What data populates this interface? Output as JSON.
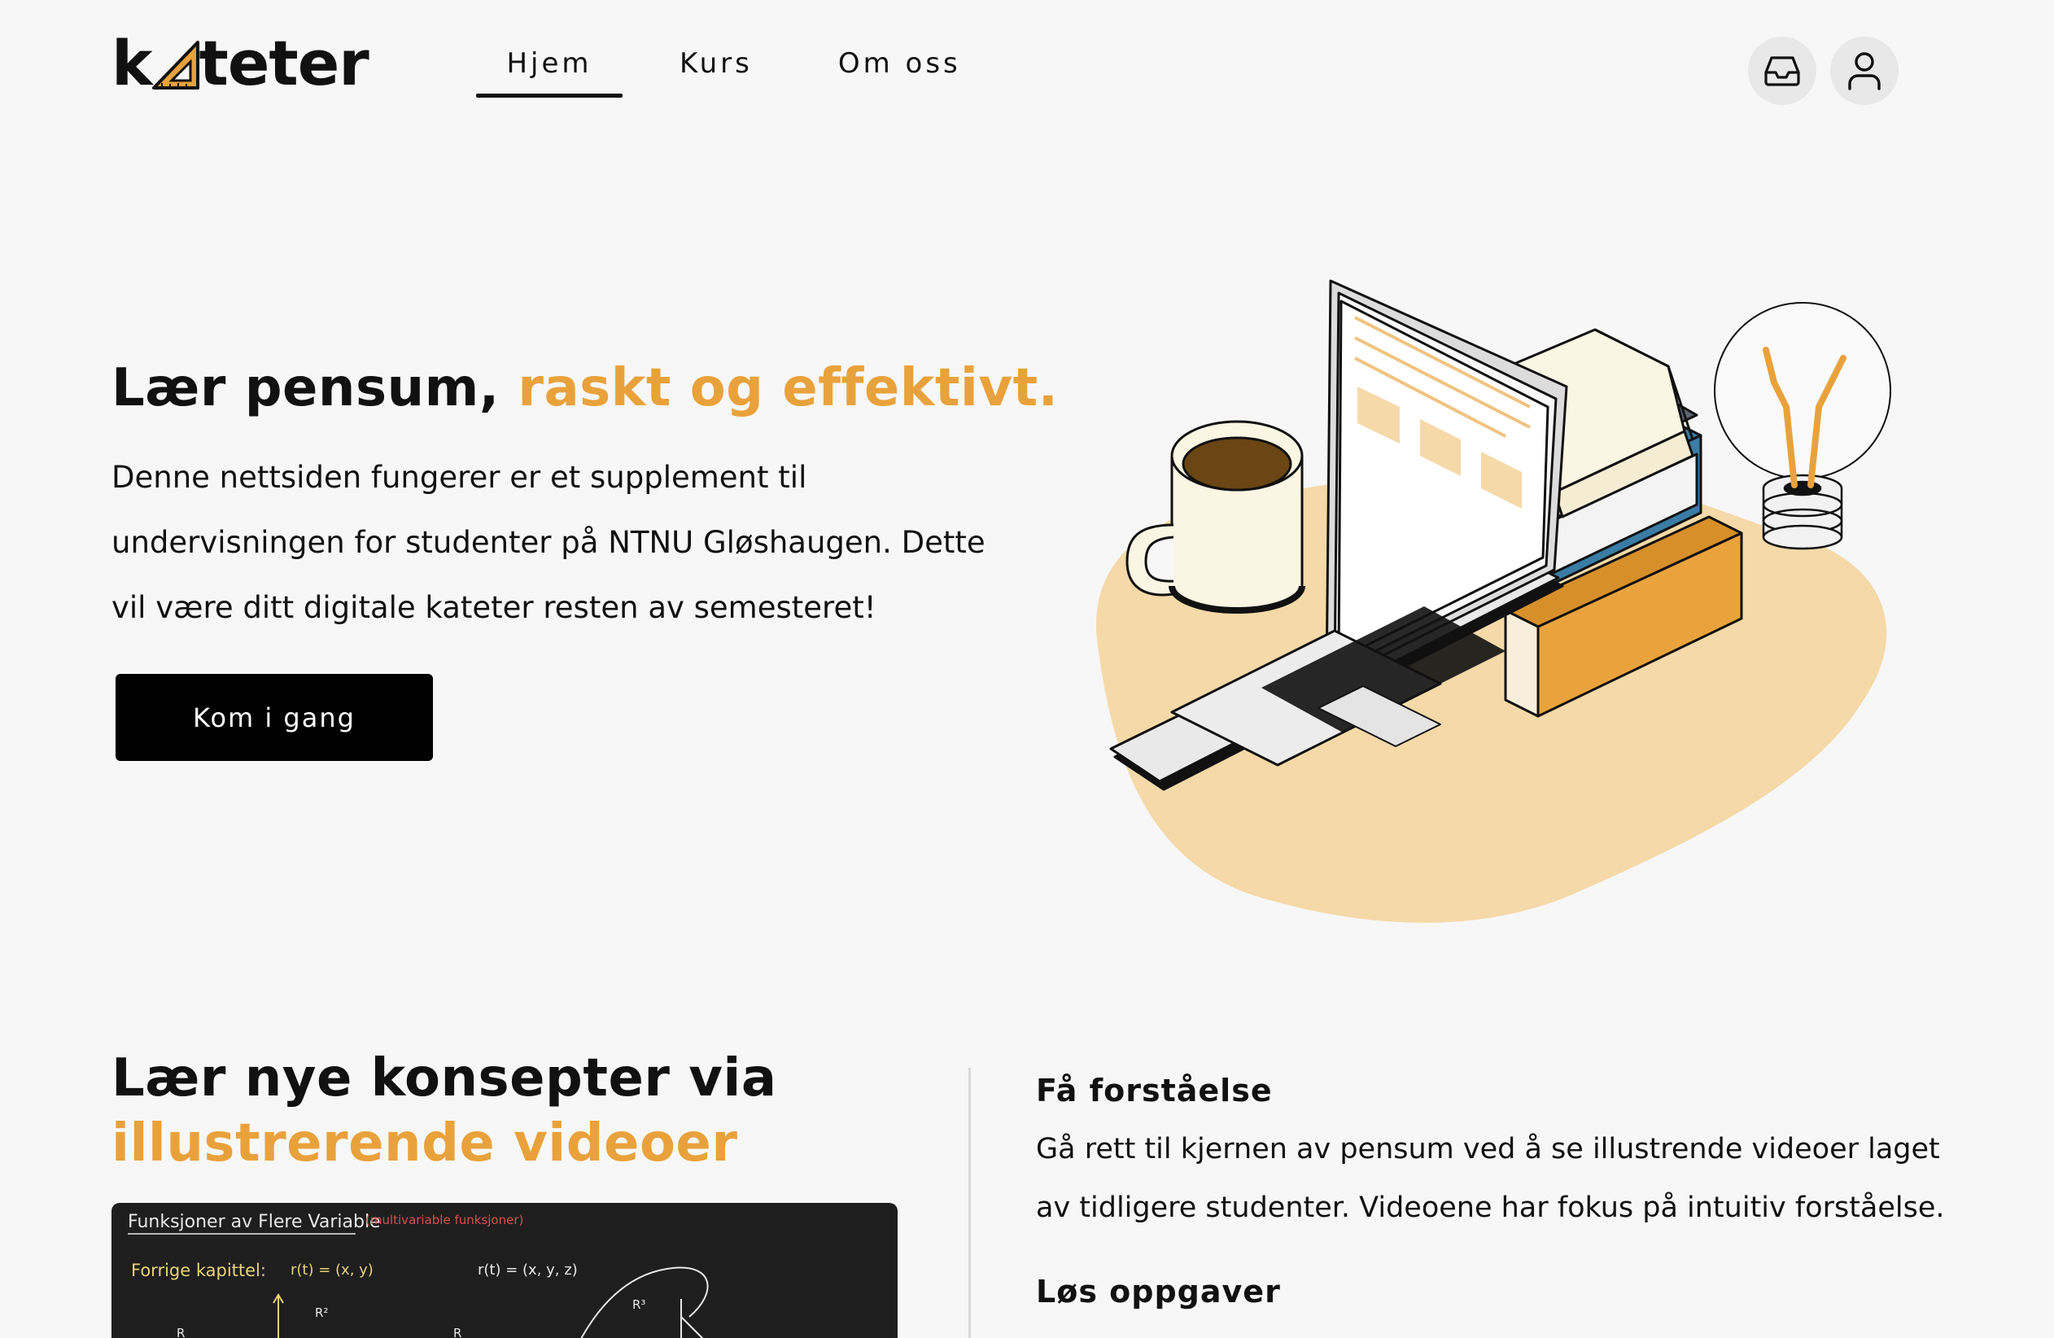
{
  "header": {
    "logo": {
      "pre": "k",
      "post": "teter"
    },
    "nav": [
      {
        "label": "Hjem",
        "active": true
      },
      {
        "label": "Kurs",
        "active": false
      },
      {
        "label": "Om oss",
        "active": false
      }
    ],
    "icons": {
      "inbox": "inbox-icon",
      "user": "user-icon"
    }
  },
  "hero": {
    "title_plain": "Lær pensum, ",
    "title_accent": "raskt og effektivt.",
    "description": "Denne nettsiden fungerer er et supplement til undervisningen for studenter på NTNU Gløshaugen. Dette vil være ditt digitale kateter resten av semesteret!",
    "cta_label": "Kom i gang"
  },
  "section2": {
    "title_plain": "Lær nye konsepter via",
    "title_accent": "illustrerende videoer",
    "video": {
      "heading": "Funksjoner av Flere Variable",
      "heading_note": "(multivariable funksjoner)",
      "line1_label": "Forrige kapittel:",
      "line1_formula": "r(t) = (x, y)",
      "line1_formula2": "r(t) = (x, y, z)",
      "axis_labels": [
        "R",
        "R²",
        "R",
        "R³"
      ]
    },
    "features": [
      {
        "title": "Få forståelse",
        "description": "Gå rett til kjernen av pensum ved å se illustrende videoer laget av tidligere studenter. Videoene har fokus på intuitiv forståelse."
      },
      {
        "title": "Løs oppgaver"
      }
    ]
  },
  "colors": {
    "accent": "#e9a23b",
    "background": "#f7f7f7",
    "dark": "#111111",
    "blob": "#f5d9a8"
  }
}
